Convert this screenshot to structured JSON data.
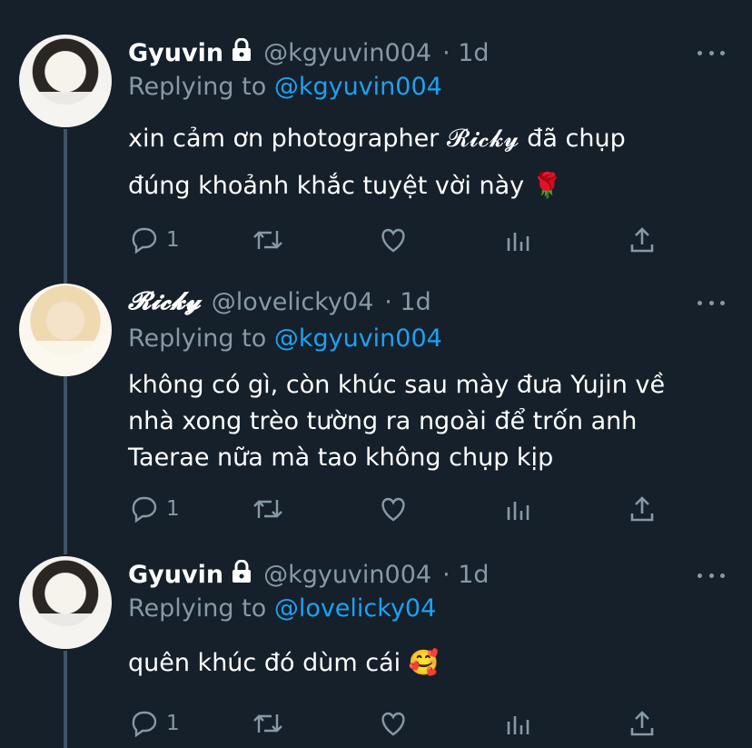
{
  "tweets": [
    {
      "author": "Gyuvin",
      "handle": "@kgyuvin004",
      "time": "· 1d",
      "replying_label": "Replying to",
      "replying_to": "@kgyuvin004",
      "body_lines": [
        "xin cảm ơn photographer 𝓡𝓲𝓬𝓴𝔂 đã chụp",
        "đúng khoảnh khắc tuyệt vời này 🌹"
      ],
      "reply_count": "1"
    },
    {
      "author": "𝓡𝓲𝓬𝓴𝔂",
      "handle": "@lovelicky04",
      "time": "· 1d",
      "replying_label": "Replying to",
      "replying_to": "@kgyuvin004",
      "body_lines": [
        "không có gì, còn khúc sau mày đưa Yujin về",
        "nhà xong trèo tường ra ngoài để trốn anh",
        "Taerae nữa mà tao không chụp kịp"
      ],
      "reply_count": "1"
    },
    {
      "author": "Gyuvin",
      "handle": "@kgyuvin004",
      "time": "· 1d",
      "replying_label": "Replying to",
      "replying_to": "@lovelicky04",
      "body_lines": [
        "quên khúc đó dùm cái 🥰"
      ],
      "reply_count": "1"
    }
  ],
  "icons": {
    "lock": "lock-icon",
    "reply": "reply-icon",
    "retweet": "retweet-icon",
    "like": "heart-icon",
    "analytics": "analytics-icon",
    "share": "share-icon",
    "more": "more-icon"
  },
  "colors": {
    "background": "#15202b",
    "secondary_text": "#8899a6",
    "mention": "#1da1f2",
    "thread_line": "#3d5466"
  }
}
